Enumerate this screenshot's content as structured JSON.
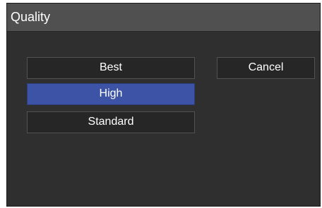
{
  "dialog": {
    "title": "Quality",
    "options": [
      {
        "label": "Best",
        "selected": false
      },
      {
        "label": "High",
        "selected": true
      },
      {
        "label": "Standard",
        "selected": false
      }
    ],
    "cancel_label": "Cancel"
  },
  "colors": {
    "background": "#2f2f2f",
    "titlebar": "#505050",
    "button": "#262626",
    "selected": "#3d54a6",
    "text": "#ffffff"
  }
}
